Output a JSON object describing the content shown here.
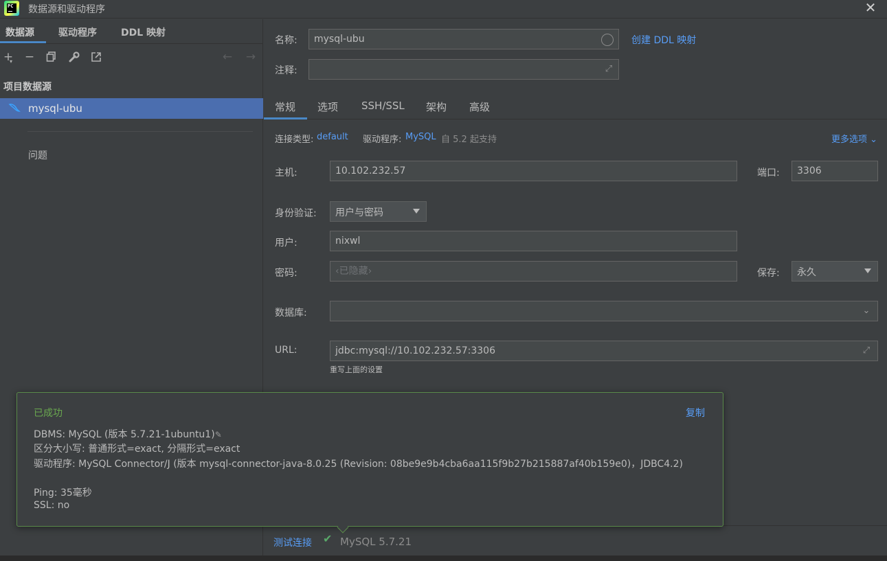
{
  "window": {
    "title": "数据源和驱动程序",
    "app_icon": "pycharm-icon",
    "close": "close-icon"
  },
  "left": {
    "tabs": [
      "数据源",
      "驱动程序",
      "DDL 映射"
    ],
    "toolbar": [
      "plus-icon",
      "minus-icon",
      "copy-icon",
      "wrench-icon",
      "export-icon",
      "arrow-left-icon",
      "arrow-right-icon"
    ],
    "section": "项目数据源",
    "datasource": "mysql-ubu",
    "problems": "问题"
  },
  "form": {
    "name_label": "名称:",
    "name_value": "mysql-ubu",
    "ddl_link": "创建 DDL 映射",
    "comment_label": "注释:",
    "comment_value": ""
  },
  "tabs": [
    "常规",
    "选项",
    "SSH/SSL",
    "架构",
    "高级"
  ],
  "general": {
    "conn_type_label": "连接类型:",
    "conn_type_value": "default",
    "driver_label": "驱动程序:",
    "driver_value": "MySQL",
    "driver_note": "自 5.2 起支持",
    "more_options": "更多选项",
    "host_label": "主机:",
    "host_value": "10.102.232.57",
    "port_label": "端口:",
    "port_value": "3306",
    "auth_label": "身份验证:",
    "auth_value": "用户与密码",
    "user_label": "用户:",
    "user_value": "nixwl",
    "password_label": "密码:",
    "password_placeholder": "‹已隐藏›",
    "save_label": "保存:",
    "save_value": "永久",
    "database_label": "数据库:",
    "database_value": "",
    "url_label": "URL:",
    "url_value": "jdbc:mysql://10.102.232.57:3306",
    "url_hint": "重写上面的设置"
  },
  "popup": {
    "title": "已成功",
    "copy": "复制",
    "dbms": "DBMS: MySQL (版本 5.7.21-1ubuntu1)",
    "case": "区分大小写: 普通形式=exact, 分隔形式=exact",
    "driver": "驱动程序: MySQL Connector/J (版本 mysql-connector-java-8.0.25 (Revision: 08be9e9b4cba6aa115f9b27b215887af40b159e0)，JDBC4.2)",
    "ping": "Ping: 35毫秒",
    "ssl": "SSL: no"
  },
  "bottom": {
    "test_link": "测试连接",
    "result": "MySQL 5.7.21"
  },
  "colors": {
    "accent": "#4a88c7",
    "selection": "#4b6eaf",
    "link": "#589df6",
    "success": "#6aa84f",
    "bg": "#3c3f41"
  }
}
